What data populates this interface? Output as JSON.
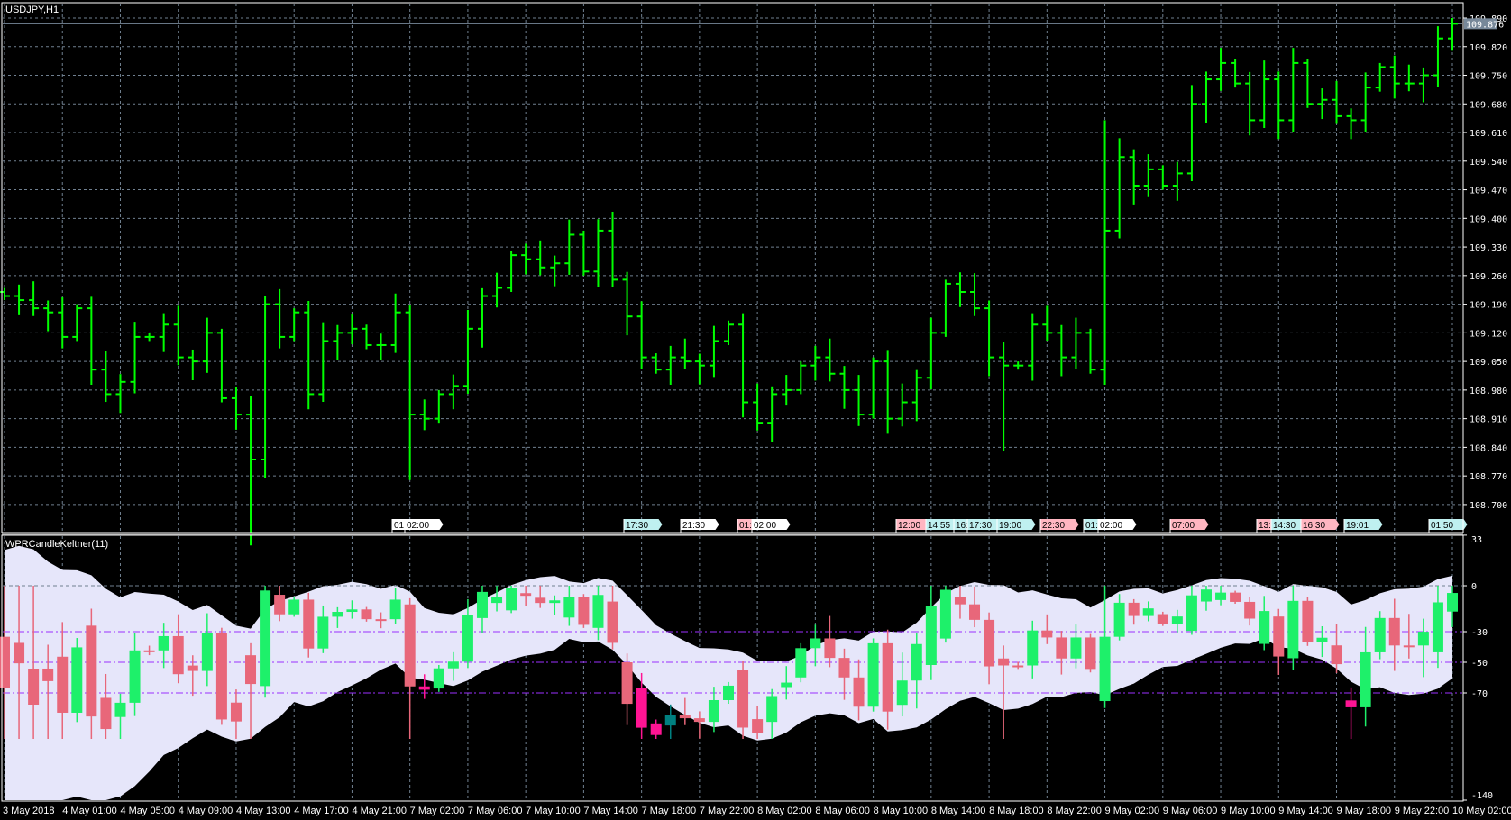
{
  "window": {
    "symbol_title": "USDJPY,H1",
    "indicator_title": "WPRCandleKeltner(11)"
  },
  "colors": {
    "background": "#000000",
    "bar": "#00ff00",
    "grid": "#708090",
    "bull": "#1ef06a",
    "bear": "#e8677a",
    "bear_outside": "#ff1493",
    "bull_outside": "#008080",
    "band": "#e6e6fa",
    "level": "#9b30ff",
    "price_line": "#778899"
  },
  "price_axis": {
    "labels": [
      "109.890",
      "109.820",
      "109.750",
      "109.680",
      "109.610",
      "109.540",
      "109.470",
      "109.400",
      "109.330",
      "109.260",
      "109.190",
      "109.120",
      "109.050",
      "108.980",
      "108.910",
      "108.840",
      "108.770",
      "108.700"
    ],
    "current_price": "109.876"
  },
  "indicator_axis": {
    "labels": [
      "33",
      "0",
      "-30",
      "-50",
      "-70",
      "-140"
    ]
  },
  "time_axis": {
    "labels": [
      "3 May 2018",
      "4 May 01:00",
      "4 May 05:00",
      "4 May 09:00",
      "4 May 13:00",
      "4 May 17:00",
      "4 May 21:00",
      "7 May 02:00",
      "7 May 06:00",
      "7 May 10:00",
      "7 May 14:00",
      "7 May 18:00",
      "7 May 22:00",
      "8 May 02:00",
      "8 May 06:00",
      "8 May 10:00",
      "8 May 14:00",
      "8 May 18:00",
      "8 May 22:00",
      "9 May 02:00",
      "9 May 06:00",
      "9 May 10:00",
      "9 May 14:00",
      "9 May 18:00",
      "9 May 22:00",
      "10 May 02:00"
    ]
  },
  "event_badges": [
    {
      "text": "01:",
      "color": "white"
    },
    {
      "text": "02:00",
      "color": "white"
    },
    {
      "text": "17:30",
      "color": "cyan"
    },
    {
      "text": "21:30",
      "color": "white"
    },
    {
      "text": "01:",
      "color": "pink"
    },
    {
      "text": "02:00",
      "color": "white"
    },
    {
      "text": "12:00",
      "color": "pink"
    },
    {
      "text": "14:55",
      "color": "cyan"
    },
    {
      "text": "16:",
      "color": "cyan"
    },
    {
      "text": "17:30",
      "color": "cyan"
    },
    {
      "text": "19:00",
      "color": "cyan"
    },
    {
      "text": "22:30",
      "color": "pink"
    },
    {
      "text": "01:",
      "color": "cyan"
    },
    {
      "text": "02:00",
      "color": "white"
    },
    {
      "text": "07:00",
      "color": "pink"
    },
    {
      "text": "13:",
      "color": "pink"
    },
    {
      "text": "14:30",
      "color": "cyan"
    },
    {
      "text": "16:30",
      "color": "pink"
    },
    {
      "text": "19:01",
      "color": "cyan"
    },
    {
      "text": "01:50",
      "color": "cyan"
    }
  ],
  "chart_data": {
    "type": "ohlc",
    "timeframe": "H1",
    "ylim": [
      108.68,
      109.91
    ],
    "indicator_ylim": [
      -140,
      33
    ],
    "indicator_levels": [
      0,
      -30,
      -50,
      -70
    ],
    "closes": [
      109.21,
      109.2,
      109.18,
      109.17,
      109.11,
      109.18,
      109.03,
      108.97,
      109.0,
      109.11,
      109.11,
      109.14,
      109.06,
      109.05,
      109.12,
      108.96,
      108.92,
      108.81,
      109.19,
      109.11,
      109.17,
      108.97,
      109.1,
      109.12,
      109.13,
      109.09,
      109.09,
      109.17,
      108.92,
      108.91,
      108.97,
      108.99,
      109.13,
      109.21,
      109.23,
      109.31,
      109.3,
      109.28,
      109.29,
      109.36,
      109.27,
      109.37,
      109.25,
      109.16,
      109.06,
      109.03,
      109.06,
      109.05,
      109.04,
      109.1,
      109.14,
      108.95,
      108.9,
      108.97,
      108.98,
      109.04,
      109.06,
      109.02,
      108.98,
      108.92,
      109.05,
      108.91,
      108.95,
      109.01,
      109.12,
      109.24,
      109.22,
      109.18,
      109.06,
      109.04,
      109.04,
      109.14,
      109.12,
      109.06,
      109.12,
      109.03,
      109.37,
      109.55,
      109.48,
      109.52,
      109.48,
      109.51,
      109.68,
      109.74,
      109.78,
      109.73,
      109.64,
      109.74,
      109.64,
      109.78,
      109.68,
      109.69,
      109.65,
      109.64,
      109.72,
      109.77,
      109.73,
      109.73,
      109.75,
      109.84,
      109.876
    ]
  }
}
